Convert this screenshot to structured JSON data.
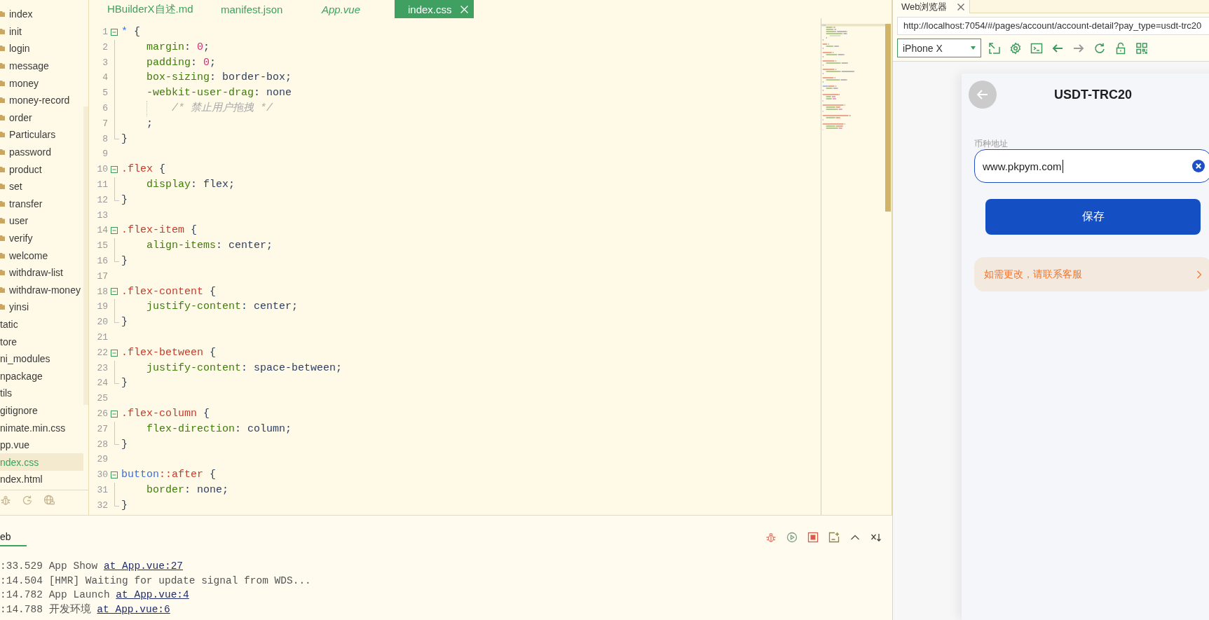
{
  "sidebar": {
    "items": [
      {
        "label": "index",
        "kind": "folder",
        "selected": false
      },
      {
        "label": "init",
        "kind": "folder",
        "selected": false
      },
      {
        "label": "login",
        "kind": "folder",
        "selected": false
      },
      {
        "label": "message",
        "kind": "folder",
        "selected": false
      },
      {
        "label": "money",
        "kind": "folder",
        "selected": false
      },
      {
        "label": "money-record",
        "kind": "folder",
        "selected": false
      },
      {
        "label": "order",
        "kind": "folder",
        "selected": false
      },
      {
        "label": "Particulars",
        "kind": "folder",
        "selected": false
      },
      {
        "label": "password",
        "kind": "folder",
        "selected": false
      },
      {
        "label": "product",
        "kind": "folder",
        "selected": false
      },
      {
        "label": "set",
        "kind": "folder",
        "selected": false
      },
      {
        "label": "transfer",
        "kind": "folder",
        "selected": false
      },
      {
        "label": "user",
        "kind": "folder",
        "selected": false
      },
      {
        "label": "verify",
        "kind": "folder",
        "selected": false
      },
      {
        "label": "welcome",
        "kind": "folder",
        "selected": false
      },
      {
        "label": "withdraw-list",
        "kind": "folder",
        "selected": false
      },
      {
        "label": "withdraw-money",
        "kind": "folder",
        "selected": false
      },
      {
        "label": "yinsi",
        "kind": "folder",
        "selected": false
      },
      {
        "label": "tatic",
        "kind": "plain",
        "selected": false
      },
      {
        "label": "tore",
        "kind": "plain",
        "selected": false
      },
      {
        "label": "ni_modules",
        "kind": "plain",
        "selected": false
      },
      {
        "label": "npackage",
        "kind": "plain",
        "selected": false
      },
      {
        "label": "tils",
        "kind": "plain",
        "selected": false
      },
      {
        "label": "gitignore",
        "kind": "plain",
        "selected": false
      },
      {
        "label": "nimate.min.css",
        "kind": "plain",
        "selected": false
      },
      {
        "label": "pp.vue",
        "kind": "plain",
        "selected": false
      },
      {
        "label": "ndex.css",
        "kind": "plain",
        "selected": true
      },
      {
        "label": "ndex.html",
        "kind": "plain",
        "selected": false
      }
    ]
  },
  "editor": {
    "tabs": [
      {
        "label": "HBuilderX自述.md",
        "selected": false,
        "preview": false
      },
      {
        "label": "manifest.json",
        "selected": false,
        "preview": false
      },
      {
        "label": "App.vue",
        "selected": false,
        "preview": true
      },
      {
        "label": "index.css",
        "selected": true,
        "preview": false
      }
    ],
    "lines": [
      {
        "number": "1",
        "kind": "open",
        "tokens": [
          {
            "kind": "tag",
            "text": "*"
          },
          {
            "kind": "punct",
            "text": " {"
          }
        ]
      },
      {
        "number": "2",
        "kind": "body",
        "tokens": [
          {
            "kind": "property",
            "text": "margin"
          },
          {
            "kind": "punct",
            "text": ": "
          },
          {
            "kind": "number",
            "text": "0"
          },
          {
            "kind": "punct",
            "text": ";"
          }
        ]
      },
      {
        "number": "3",
        "kind": "body",
        "tokens": [
          {
            "kind": "property",
            "text": "padding"
          },
          {
            "kind": "punct",
            "text": ": "
          },
          {
            "kind": "number",
            "text": "0"
          },
          {
            "kind": "punct",
            "text": ";"
          }
        ]
      },
      {
        "number": "4",
        "kind": "body",
        "tokens": [
          {
            "kind": "property",
            "text": "box-sizing"
          },
          {
            "kind": "punct",
            "text": ": "
          },
          {
            "kind": "value",
            "text": "border-box"
          },
          {
            "kind": "punct",
            "text": ";"
          }
        ]
      },
      {
        "number": "5",
        "kind": "body",
        "tokens": [
          {
            "kind": "property",
            "text": "-webkit-user-drag"
          },
          {
            "kind": "punct",
            "text": ": "
          },
          {
            "kind": "value",
            "text": "none"
          }
        ]
      },
      {
        "number": "6",
        "kind": "nested",
        "tokens": [
          {
            "kind": "comment",
            "text": "/* 禁止用户拖拽 */"
          }
        ]
      },
      {
        "number": "7",
        "kind": "body",
        "tokens": [
          {
            "kind": "punct",
            "text": ";"
          }
        ]
      },
      {
        "number": "8",
        "kind": "close",
        "tokens": [
          {
            "kind": "punct",
            "text": "}"
          }
        ]
      },
      {
        "number": "9",
        "kind": "blank"
      },
      {
        "number": "10",
        "kind": "open",
        "tokens": [
          {
            "kind": "selector",
            "text": ".flex"
          },
          {
            "kind": "punct",
            "text": " {"
          }
        ]
      },
      {
        "number": "11",
        "kind": "body",
        "tokens": [
          {
            "kind": "property",
            "text": "display"
          },
          {
            "kind": "punct",
            "text": ": "
          },
          {
            "kind": "value",
            "text": "flex"
          },
          {
            "kind": "punct",
            "text": ";"
          }
        ]
      },
      {
        "number": "12",
        "kind": "close",
        "tokens": [
          {
            "kind": "punct",
            "text": "}"
          }
        ]
      },
      {
        "number": "13",
        "kind": "blank"
      },
      {
        "number": "14",
        "kind": "open",
        "tokens": [
          {
            "kind": "selector",
            "text": ".flex-item"
          },
          {
            "kind": "punct",
            "text": " {"
          }
        ]
      },
      {
        "number": "15",
        "kind": "body",
        "tokens": [
          {
            "kind": "property",
            "text": "align-items"
          },
          {
            "kind": "punct",
            "text": ": "
          },
          {
            "kind": "value",
            "text": "center"
          },
          {
            "kind": "punct",
            "text": ";"
          }
        ]
      },
      {
        "number": "16",
        "kind": "close",
        "tokens": [
          {
            "kind": "punct",
            "text": "}"
          }
        ]
      },
      {
        "number": "17",
        "kind": "blank"
      },
      {
        "number": "18",
        "kind": "open",
        "tokens": [
          {
            "kind": "selector",
            "text": ".flex-content"
          },
          {
            "kind": "punct",
            "text": " {"
          }
        ]
      },
      {
        "number": "19",
        "kind": "body",
        "tokens": [
          {
            "kind": "property",
            "text": "justify-content"
          },
          {
            "kind": "punct",
            "text": ": "
          },
          {
            "kind": "value",
            "text": "center"
          },
          {
            "kind": "punct",
            "text": ";"
          }
        ]
      },
      {
        "number": "20",
        "kind": "close",
        "tokens": [
          {
            "kind": "punct",
            "text": "}"
          }
        ]
      },
      {
        "number": "21",
        "kind": "blank"
      },
      {
        "number": "22",
        "kind": "open",
        "tokens": [
          {
            "kind": "selector",
            "text": ".flex-between"
          },
          {
            "kind": "punct",
            "text": " {"
          }
        ]
      },
      {
        "number": "23",
        "kind": "body",
        "tokens": [
          {
            "kind": "property",
            "text": "justify-content"
          },
          {
            "kind": "punct",
            "text": ": "
          },
          {
            "kind": "value",
            "text": "space-between"
          },
          {
            "kind": "punct",
            "text": ";"
          }
        ]
      },
      {
        "number": "24",
        "kind": "close",
        "tokens": [
          {
            "kind": "punct",
            "text": "}"
          }
        ]
      },
      {
        "number": "25",
        "kind": "blank"
      },
      {
        "number": "26",
        "kind": "open",
        "tokens": [
          {
            "kind": "selector",
            "text": ".flex-column"
          },
          {
            "kind": "punct",
            "text": " {"
          }
        ]
      },
      {
        "number": "27",
        "kind": "body",
        "tokens": [
          {
            "kind": "property",
            "text": "flex-direction"
          },
          {
            "kind": "punct",
            "text": ": "
          },
          {
            "kind": "value",
            "text": "column"
          },
          {
            "kind": "punct",
            "text": ";"
          }
        ]
      },
      {
        "number": "28",
        "kind": "close",
        "tokens": [
          {
            "kind": "punct",
            "text": "}"
          }
        ]
      },
      {
        "number": "29",
        "kind": "blank"
      },
      {
        "number": "30",
        "kind": "open",
        "tokens": [
          {
            "kind": "tag",
            "text": "button"
          },
          {
            "kind": "selector",
            "text": "::after"
          },
          {
            "kind": "punct",
            "text": " {"
          }
        ]
      },
      {
        "number": "31",
        "kind": "body",
        "tokens": [
          {
            "kind": "property",
            "text": "border"
          },
          {
            "kind": "punct",
            "text": ": "
          },
          {
            "kind": "value",
            "text": "none"
          },
          {
            "kind": "punct",
            "text": ";"
          }
        ]
      },
      {
        "number": "32",
        "kind": "close",
        "tokens": [
          {
            "kind": "punct",
            "text": "}"
          }
        ]
      }
    ]
  },
  "console": {
    "tabs": [
      {
        "label": "eb",
        "selected": true
      }
    ],
    "lines": [
      {
        "time": ":33.529",
        "message": "App Show",
        "link": "at App.vue:27"
      },
      {
        "time": ":14.504",
        "message": "[HMR] Waiting for update signal from WDS..."
      },
      {
        "time": ":14.782",
        "message": "App Launch",
        "link": "at App.vue:4"
      },
      {
        "time": ":14.788",
        "message": "开发环境",
        "link": "at App.vue:6"
      }
    ]
  },
  "browser": {
    "tab": {
      "label": "Web浏览器",
      "selected": true
    },
    "url": "http://localhost:7054/#/pages/account/account-detail?pay_type=usdt-trc20",
    "device": "iPhone X",
    "page": {
      "title": "USDT-TRC20",
      "field": {
        "label": "币种地址",
        "value": "www.pkpym.com",
        "focused": true
      },
      "button": "保存",
      "notice": "如需更改，请联系客服"
    }
  }
}
